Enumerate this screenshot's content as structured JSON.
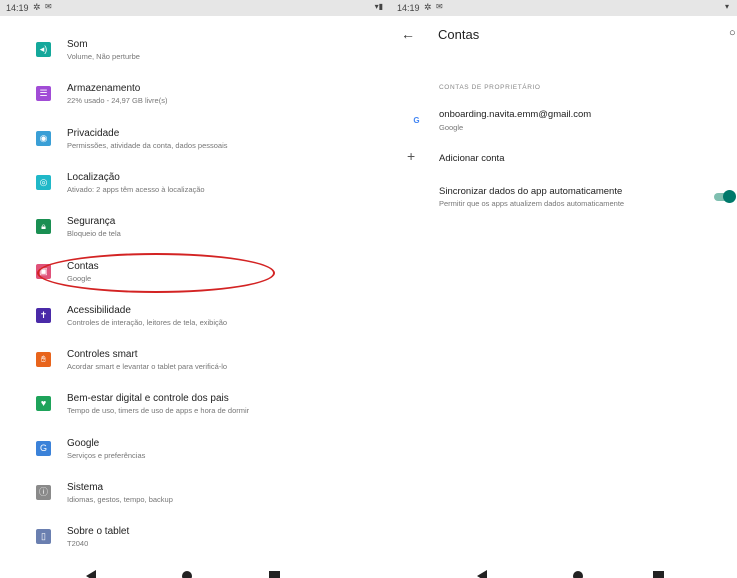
{
  "left_status": {
    "time": "14:19"
  },
  "right_status": {
    "time": "14:19"
  },
  "settings_items": [
    {
      "key": "som",
      "icon": "sound-icon",
      "glyph": "◂)",
      "color": "#14a89b",
      "title": "Som",
      "subtitle": "Volume, Não perturbe"
    },
    {
      "key": "armazenamento",
      "icon": "storage-icon",
      "glyph": "☰",
      "color": "#a14cd6",
      "title": "Armazenamento",
      "subtitle": "22% usado - 24,97 GB livre(s)"
    },
    {
      "key": "privacidade",
      "icon": "privacy-icon",
      "glyph": "◉",
      "color": "#3a9fd6",
      "title": "Privacidade",
      "subtitle": "Permissões, atividade da conta, dados pessoais"
    },
    {
      "key": "localizacao",
      "icon": "location-icon",
      "glyph": "◎",
      "color": "#20b8c8",
      "title": "Localização",
      "subtitle": "Ativado: 2 apps têm acesso à localização"
    },
    {
      "key": "seguranca",
      "icon": "lock-icon",
      "glyph": "🔒︎",
      "color": "#1a8f52",
      "title": "Segurança",
      "subtitle": "Bloqueio de tela"
    },
    {
      "key": "contas",
      "icon": "account-icon",
      "glyph": "▣",
      "color": "#e0527a",
      "title": "Contas",
      "subtitle": "Google"
    },
    {
      "key": "acessibilidade",
      "icon": "accessibility-icon",
      "glyph": "✝",
      "color": "#4a2aa8",
      "title": "Acessibilidade",
      "subtitle": "Controles de interação, leitores de tela, exibição"
    },
    {
      "key": "controles",
      "icon": "hand-icon",
      "glyph": "✋︎",
      "color": "#e8641c",
      "title": "Controles smart",
      "subtitle": "Acordar smart e levantar o tablet para verificá-lo"
    },
    {
      "key": "bemestar",
      "icon": "wellbeing-icon",
      "glyph": "♥",
      "color": "#1ea35a",
      "title": "Bem-estar digital e controle dos pais",
      "subtitle": "Tempo de uso, timers de uso de apps e hora de dormir"
    },
    {
      "key": "google",
      "icon": "google-icon",
      "glyph": "G",
      "color": "#3b82d9",
      "title": "Google",
      "subtitle": "Serviços e preferências"
    },
    {
      "key": "sistema",
      "icon": "info-icon",
      "glyph": "ⓘ",
      "color": "#8a8a8a",
      "title": "Sistema",
      "subtitle": "Idiomas, gestos, tempo, backup"
    },
    {
      "key": "sobre",
      "icon": "tablet-icon",
      "glyph": "▯",
      "color": "#6a7fb0",
      "title": "Sobre o tablet",
      "subtitle": "T2040"
    }
  ],
  "accounts_screen": {
    "title": "Contas",
    "section_label": "CONTAS DE PROPRIETÁRIO",
    "account": {
      "email": "onboarding.navita.emm@gmail.com",
      "provider": "Google"
    },
    "add_account_label": "Adicionar conta",
    "sync": {
      "title": "Sincronizar dados do app automaticamente",
      "subtitle": "Permitir que os apps atualizem dados automaticamente",
      "enabled": true,
      "accent": "#00796b"
    }
  }
}
